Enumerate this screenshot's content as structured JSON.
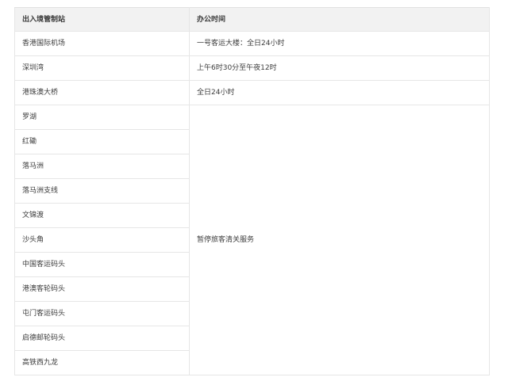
{
  "table": {
    "headers": [
      "出入境管制站",
      "办公时间"
    ],
    "rows": [
      {
        "station": "香港国际机场",
        "hours": "一号客运大楼：全日24小时"
      },
      {
        "station": "深圳湾",
        "hours": "上午6时30分至午夜12时"
      },
      {
        "station": "港珠澳大桥",
        "hours": "全日24小时"
      },
      {
        "station": "罗湖"
      },
      {
        "station": "红磡"
      },
      {
        "station": "落马洲"
      },
      {
        "station": "落马洲支线"
      },
      {
        "station": "文锦渡"
      },
      {
        "station": "沙头角"
      },
      {
        "station": "中国客运码头"
      },
      {
        "station": "港澳客轮码头"
      },
      {
        "station": "屯门客运码头"
      },
      {
        "station": "启德邮轮码头"
      },
      {
        "station": "高铁西九龙"
      }
    ],
    "merged_hours": "暂停旅客清关服务"
  }
}
